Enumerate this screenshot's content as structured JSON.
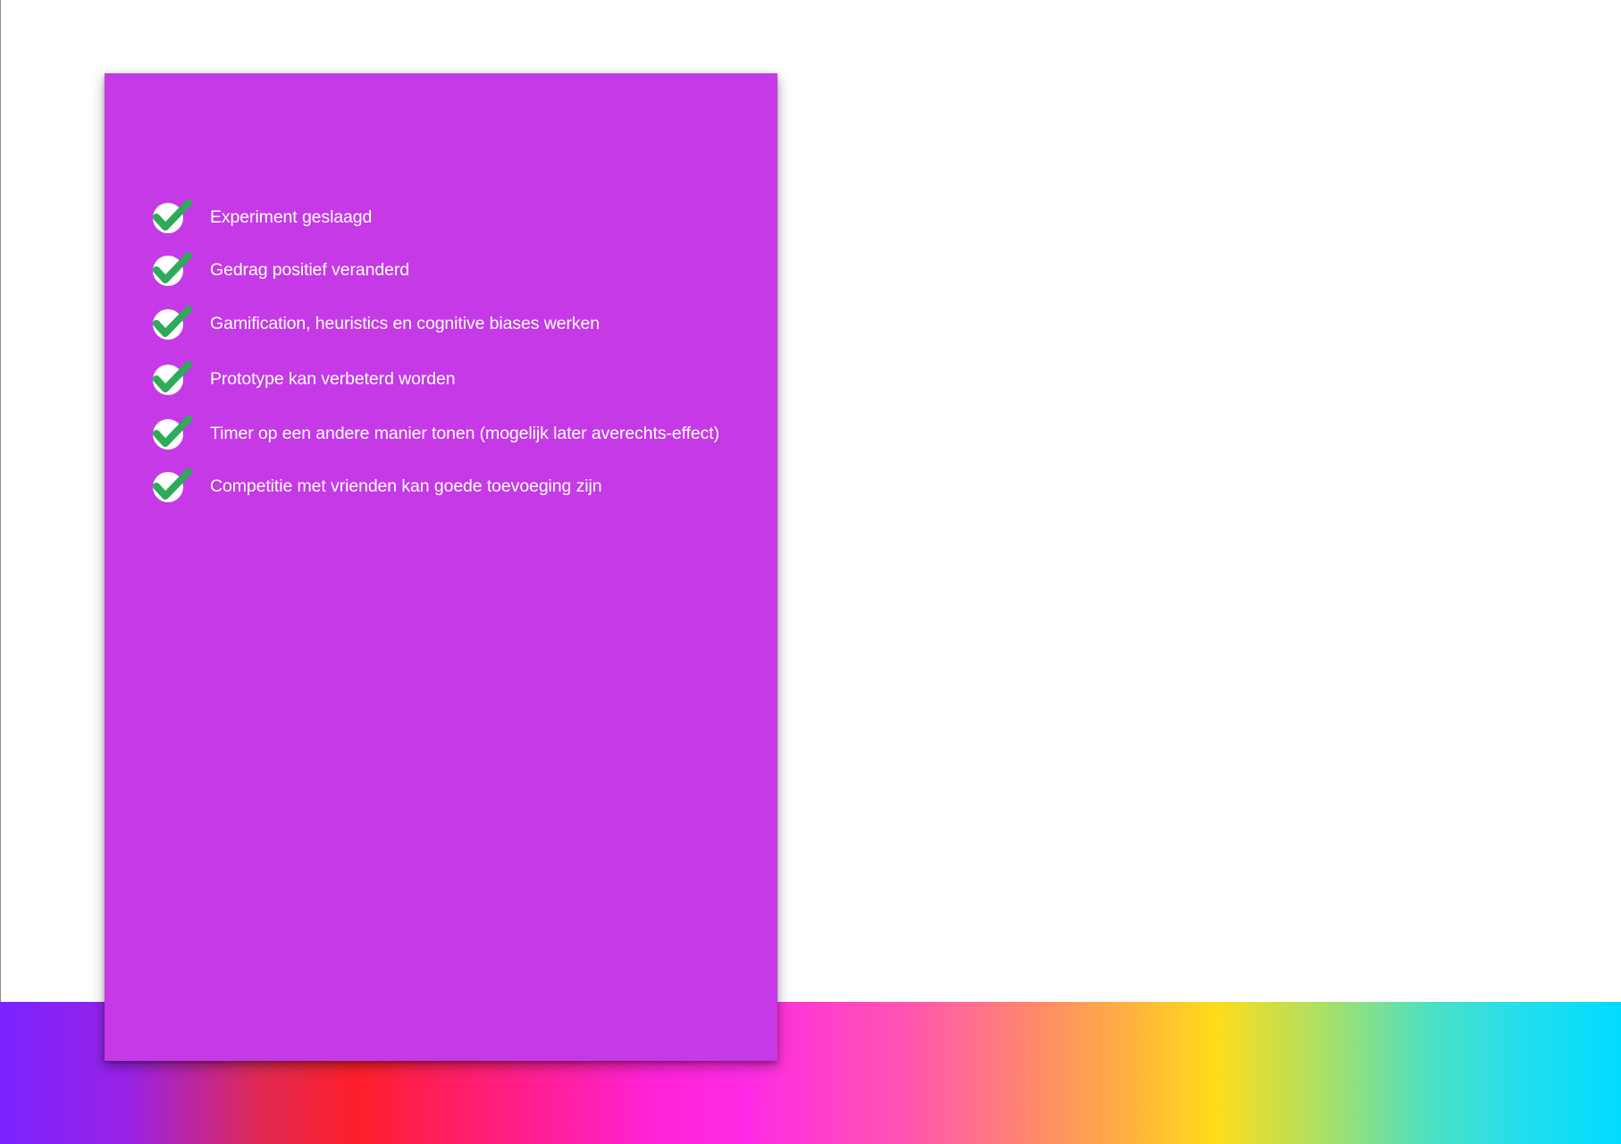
{
  "checklist": {
    "items": [
      {
        "label": "Experiment geslaagd"
      },
      {
        "label": "Gedrag positief veranderd"
      },
      {
        "label": "Gamification, heuristics en cognitive biases werken"
      },
      {
        "label": "Prototype kan verbeterd worden"
      },
      {
        "label": "Timer op een andere manier tonen (mogelijk later averechts-effect)"
      },
      {
        "label": "Competitie met vrienden kan goede toevoeging zijn"
      }
    ],
    "icon": "check-circle-icon"
  },
  "colors": {
    "card": "#c539e7",
    "label_text": "#ffffff",
    "check_green": "#2eaa58",
    "check_circle": "#ffffff"
  }
}
